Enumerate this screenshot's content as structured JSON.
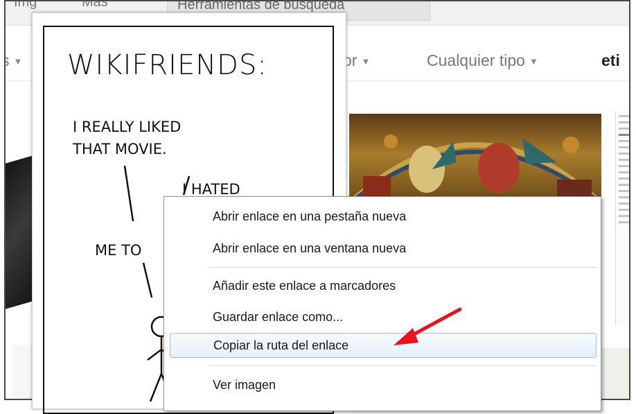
{
  "top_tabs": {
    "images_fragment": "Img",
    "more_fragment": "Más",
    "search_tools": "Herramientas de búsqueda"
  },
  "filters": {
    "left_fragment": "s",
    "color_fragment": "or",
    "type": "Cualquier tipo",
    "label_fragment": "eti"
  },
  "comic": {
    "title": "WIKIFRIENDS:",
    "line1": "I REALLY LIKED",
    "line2": "THAT MOVIE.",
    "line3": "I HATED",
    "line4": "ME TO"
  },
  "context_menu": {
    "items": [
      "Abrir enlace en una pestaña nueva",
      "Abrir enlace en una ventana nueva",
      "Añadir este enlace a marcadores",
      "Guardar enlace como...",
      "Copiar la ruta del enlace",
      "Ver imagen"
    ],
    "highlighted_index": 4
  },
  "colors": {
    "annotation_arrow": "#e8141a",
    "menu_highlight_border": "#9dbde6"
  }
}
